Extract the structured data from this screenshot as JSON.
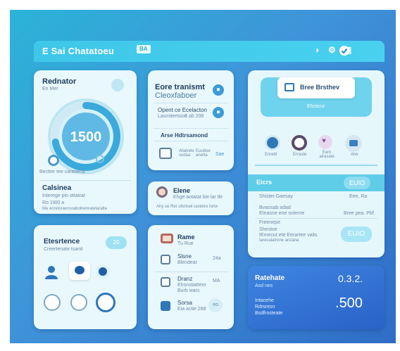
{
  "header": {
    "title": "E Sai Chatatoeu",
    "chip": "BA",
    "icons": [
      "toggle-icon",
      "settings-icon",
      "window-icon",
      "check-icon"
    ]
  },
  "left_top": {
    "title": "Rednator",
    "subtitle": "En Mer",
    "gauge_value": "1500",
    "gauge_fraction": 0.72,
    "caption": "Bectter tee caratierat",
    "section_title": "Calsinea",
    "line1": "Interege pin ottatrat",
    "line2": "Ro 1W0 a",
    "line3": "Me ecretoraonsrabolnenratetaralte"
  },
  "left_bottom": {
    "title": "Etesrtence",
    "subtitle": "Creertenate tsanit",
    "toggle_label": "20"
  },
  "mid_top": {
    "title": "Eore tranismt",
    "subtitle": "Cleoxfaboer",
    "row1_label": "Opent ce Ecelacton",
    "row1_sub": "Lasmitertsion",
    "row1_date": "6 ab 208",
    "row2_label": "Arse Hdtrsamond",
    "stats": [
      "Aliatrele sodaa",
      "Euuttoe anetta",
      "Sae"
    ]
  },
  "mid_mid": {
    "title": "Elene",
    "line1": "Ehge aotatat bie lar tle",
    "line2": "Ahy se   Rer ofertoel rastetre Iorte"
  },
  "mid_bottom": {
    "title": "Rame",
    "subtitle": "Tu Rue",
    "items": [
      {
        "title": "Slsne",
        "sub": "Blendeat",
        "right": "24a"
      },
      {
        "title": "Dranz",
        "sub": "Ehsnstiatteor",
        "sub2": "Burb wars",
        "right": "MA"
      },
      {
        "title": "Sorsa",
        "sub": "Eia actie 288",
        "right": "eo"
      }
    ]
  },
  "right_top": {
    "button_label": "Bree Brsthev",
    "sub_label": "Ehcticur",
    "icon_labels": [
      "Enretit",
      "Erraste",
      "Eem alrasate",
      "Ahe"
    ],
    "list_header": "Eicrs",
    "list_header_pill": "EUIO",
    "rows": [
      {
        "label": "Shister Gaesay",
        "value": "Eee, Ra"
      },
      {
        "label": "Bvaosab adad",
        "value": ""
      },
      {
        "label": "Eteasne ene snlerne",
        "value": "Bree pea. Pbf"
      },
      {
        "label": "Freenepe",
        "value": ""
      },
      {
        "label": "Shestoe",
        "value": ""
      },
      {
        "label": "IEmecut ete Eerartee vaits",
        "value": ""
      },
      {
        "label": "Iarecalatrone anzana",
        "value": ""
      }
    ],
    "bottom_pill": "EUIO"
  },
  "right_bottom": {
    "title": "Ratehate",
    "subtitle": "Asd nes",
    "value_top": "0.3.2.",
    "line1": "Intacehe",
    "line2": "Rdrsresn",
    "line3": "Bsdfrosteate",
    "value_big": "500"
  },
  "colors": {
    "background": "#2f8ad0",
    "header": "#3ec7e8",
    "card": "#e9f8fc",
    "accent": "#3a9bd6",
    "pill": "#9ee2f2",
    "blue_card": "#2f6fd4"
  }
}
